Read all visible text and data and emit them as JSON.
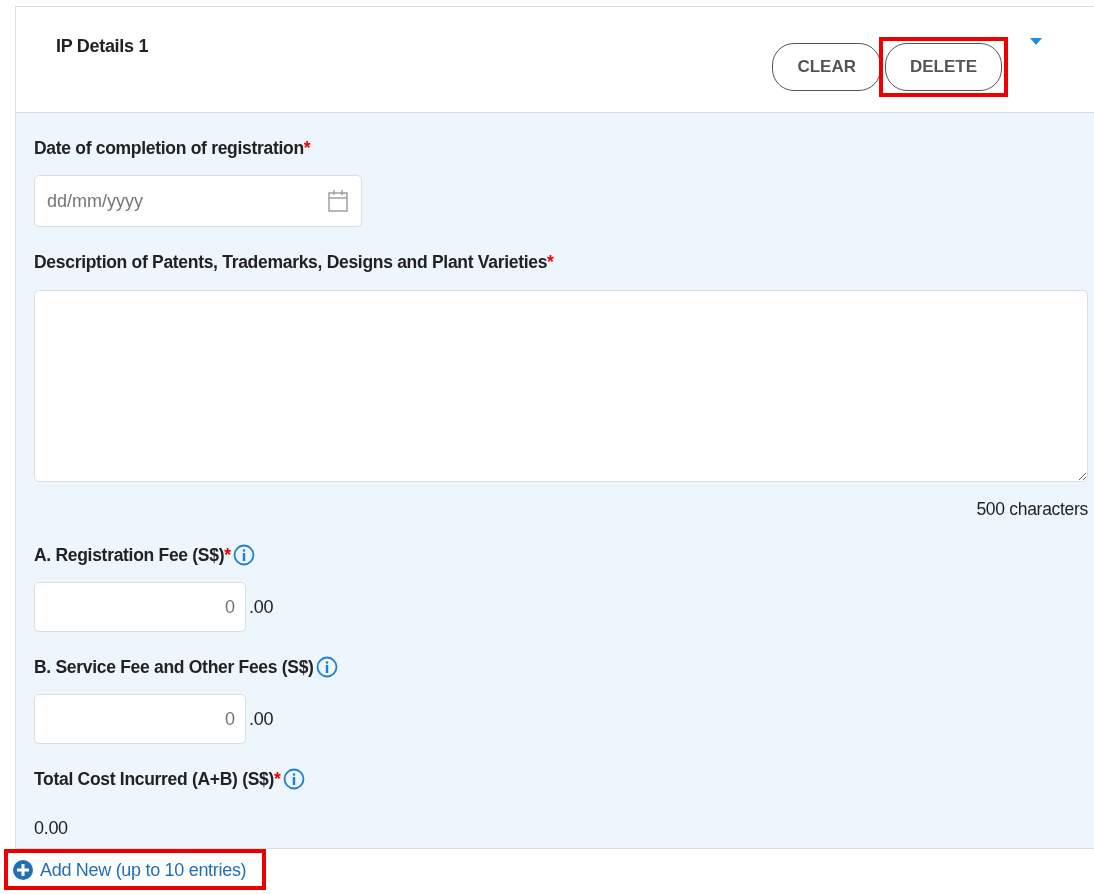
{
  "panel": {
    "title": "IP Details 1",
    "expanded": true,
    "buttons": [
      {
        "label": "CLEAR",
        "highlighted": false
      },
      {
        "label": "DELETE",
        "highlighted": true
      }
    ]
  },
  "fields": [
    {
      "kind": "date",
      "label": "Date of completion of registration",
      "required_mark": "*",
      "info": false,
      "placeholder": "dd/mm/yyyy"
    },
    {
      "kind": "textarea",
      "label": "Description of Patents, Trademarks, Designs and Plant Varieties",
      "required_mark": "*",
      "info": false,
      "counter": "500 characters"
    },
    {
      "kind": "money",
      "label": "A. Registration Fee (S$)",
      "required_mark": "*",
      "info": true,
      "placeholder": "0",
      "suffix": ".00"
    },
    {
      "kind": "money",
      "label": "B. Service Fee and Other Fees (S$)",
      "info": true,
      "placeholder": "0",
      "suffix": ".00"
    },
    {
      "kind": "total",
      "label": "Total Cost Incurred (A+B) (S$)",
      "required_mark": "*",
      "info": true,
      "value": "0.00"
    }
  ],
  "add_new": {
    "label": "Add New (up to 10 entries)",
    "highlighted": true
  }
}
